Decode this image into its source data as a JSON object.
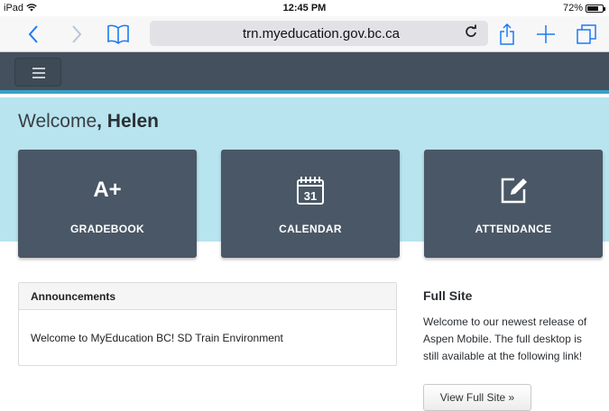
{
  "status_bar": {
    "carrier": "iPad",
    "time": "12:45 PM",
    "battery": "72%",
    "battery_level": 0.72
  },
  "browser": {
    "url": "trn.myeducation.gov.bc.ca"
  },
  "welcome": {
    "greeting": "Welcome",
    "name": ", Helen"
  },
  "tiles": [
    {
      "label": "GRADEBOOK",
      "icon": "grade-a-plus-icon",
      "glyph": "A+"
    },
    {
      "label": "CALENDAR",
      "icon": "calendar-icon",
      "glyph": "31"
    },
    {
      "label": "ATTENDANCE",
      "icon": "edit-icon"
    }
  ],
  "announcements": {
    "title": "Announcements",
    "message": "Welcome to MyEducation BC! SD Train Environment"
  },
  "full_site": {
    "title": "Full Site",
    "line1": "Welcome to our newest release of",
    "line2": "Aspen Mobile. The full desktop is",
    "line3": "still available at the following link!",
    "button_label": "View Full Site »"
  },
  "colors": {
    "navbar": "#44505d",
    "accent": "#3ba0c4",
    "band": "#b8e4ef",
    "tile": "#4a5766",
    "ios_blue": "#1a7cf4"
  }
}
